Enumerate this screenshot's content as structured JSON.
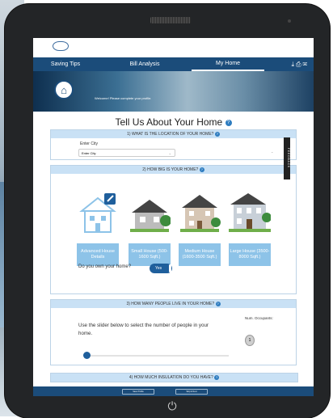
{
  "nav": {
    "items": [
      "Saving Tips",
      "Bill Analysis",
      "My Home"
    ],
    "icons": [
      "download-icon",
      "print-icon",
      "mail-icon"
    ]
  },
  "hero": {
    "welcome": "Welcome! Please complete your profile."
  },
  "page": {
    "title": "Tell Us About Your Home",
    "feedback_tab": "FEEDBACK"
  },
  "section1": {
    "heading": "1) WHAT IS THE LOCATION OF YOUR HOME?",
    "city_label": "Enter City",
    "city_placeholder": "Enter City"
  },
  "section2": {
    "heading": "2) HOW BIG IS YOUR HOME?",
    "houses": [
      {
        "label": "Advanced House Details",
        "icon": "house-edit-icon"
      },
      {
        "label": "Small House (500-1600 Sqft.)",
        "icon": "small-house-icon"
      },
      {
        "label": "Medium House (1600-3500 Sqft.)",
        "icon": "medium-house-icon"
      },
      {
        "label": "Large House (3500-8000 Sqft.)",
        "icon": "large-house-icon"
      }
    ],
    "own_question": "Do you own your home?",
    "own_toggle": "Yes"
  },
  "section3": {
    "heading": "3) HOW MANY PEOPLE LIVE IN YOUR HOME?",
    "description": "Use the slider below to select the number of people in your home.",
    "occupants_label": "Num. Occupants:",
    "occupants_value": "1"
  },
  "section4": {
    "heading": "4) HOW MUCH INSULATION DO YOU HAVE?"
  },
  "footer": {
    "buttons": [
      "Save Profile",
      "Skip & Next"
    ]
  },
  "colors": {
    "nav": "#1b4c7a",
    "section_head": "#c9e1f5",
    "house_button": "#8dc3e8",
    "toggle": "#1f5f9c"
  }
}
